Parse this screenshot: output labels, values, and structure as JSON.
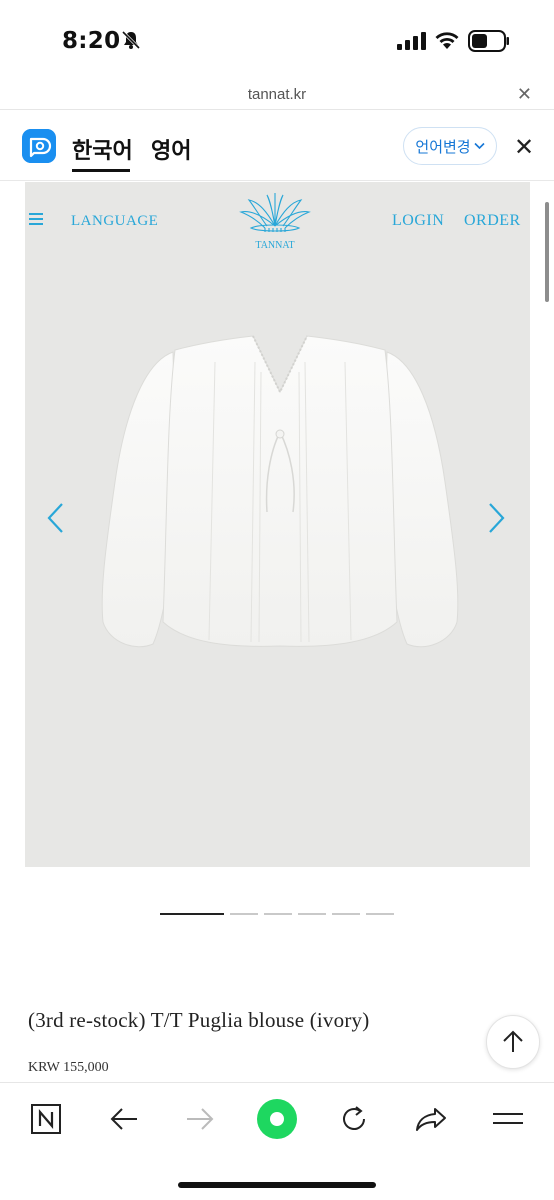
{
  "status": {
    "time": "8:20"
  },
  "urlbar": {
    "url": "tannat.kr",
    "close_glyph": "✕"
  },
  "translate": {
    "source_lang": "한국어",
    "target_lang": "영어",
    "change_label": "언어변경",
    "close_glyph": "✕"
  },
  "site_header": {
    "language_label": "LANGUAGE",
    "logo_text": "TANNAT",
    "login_label": "LOGIN",
    "order_label": "ORDER"
  },
  "carousel": {
    "slide_count": 6,
    "active_index": 0
  },
  "product": {
    "title": "(3rd re-stock) T/T Puglia blouse (ivory)",
    "price": "KRW 155,000"
  },
  "colors": {
    "accent": "#29a7d8",
    "image_bg": "#e7e7e5",
    "green_button": "#1ed760"
  },
  "icons": {
    "menu": "hamburger-icon",
    "prev": "chevron-left-icon",
    "next": "chevron-right-icon",
    "scroll_top": "arrow-up-icon",
    "toolbar": [
      "naver-n-icon",
      "back-arrow-icon",
      "forward-arrow-icon",
      "green-dot-icon",
      "refresh-icon",
      "share-icon",
      "menu-lines-icon"
    ]
  }
}
